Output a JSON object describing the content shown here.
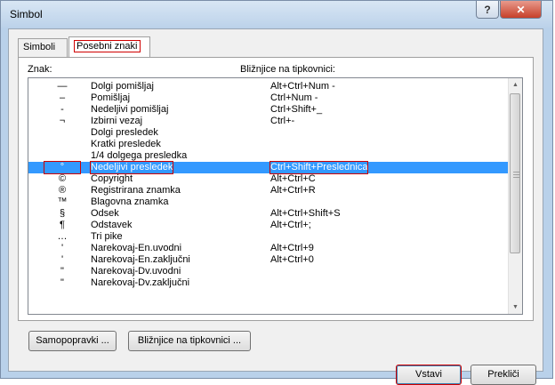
{
  "window": {
    "title": "Simbol",
    "help": "?",
    "close": "✕"
  },
  "tabs": [
    {
      "label": "Simboli"
    },
    {
      "label": "Posebni znaki"
    }
  ],
  "headers": {
    "char": "Znak:",
    "shortcut": "Bližnjice na tipkovnici:"
  },
  "rows": [
    {
      "char": "—",
      "name": "Dolgi pomišljaj",
      "shortcut": "Alt+Ctrl+Num -"
    },
    {
      "char": "–",
      "name": "Pomišljaj",
      "shortcut": "Ctrl+Num -"
    },
    {
      "char": "‑",
      "name": "Nedeljivi pomišljaj",
      "shortcut": "Ctrl+Shift+_"
    },
    {
      "char": "¬",
      "name": "Izbirni vezaj",
      "shortcut": "Ctrl+-"
    },
    {
      "char": "",
      "name": "Dolgi presledek",
      "shortcut": ""
    },
    {
      "char": "",
      "name": "Kratki presledek",
      "shortcut": ""
    },
    {
      "char": "",
      "name": "1/4 dolgega presledka",
      "shortcut": ""
    },
    {
      "char": "°",
      "name": "Nedeljivi presledek",
      "shortcut": "Ctrl+Shift+Preslednica"
    },
    {
      "char": "©",
      "name": "Copyright",
      "shortcut": "Alt+Ctrl+C"
    },
    {
      "char": "®",
      "name": "Registrirana znamka",
      "shortcut": "Alt+Ctrl+R"
    },
    {
      "char": "™",
      "name": "Blagovna znamka",
      "shortcut": ""
    },
    {
      "char": "§",
      "name": "Odsek",
      "shortcut": "Alt+Ctrl+Shift+S"
    },
    {
      "char": "¶",
      "name": "Odstavek",
      "shortcut": "Alt+Ctrl+;"
    },
    {
      "char": "…",
      "name": "Tri pike",
      "shortcut": ""
    },
    {
      "char": "'",
      "name": "Narekovaj-En.uvodni",
      "shortcut": "Alt+Ctrl+9"
    },
    {
      "char": "'",
      "name": "Narekovaj-En.zaključni",
      "shortcut": "Alt+Ctrl+0"
    },
    {
      "char": "\"",
      "name": "Narekovaj-Dv.uvodni",
      "shortcut": ""
    },
    {
      "char": "\"",
      "name": "Narekovaj-Dv.zaključni",
      "shortcut": ""
    }
  ],
  "selected_index": 7,
  "buttons": {
    "autocorrect": "Samopopravki ...",
    "shortcut_key": "Bližnjice na tipkovnici ...",
    "insert": "Vstavi",
    "cancel": "Prekliči"
  },
  "colors": {
    "selection": "#3399ff",
    "highlight_border": "#d00000",
    "titlebar": "#bcd2ea"
  }
}
